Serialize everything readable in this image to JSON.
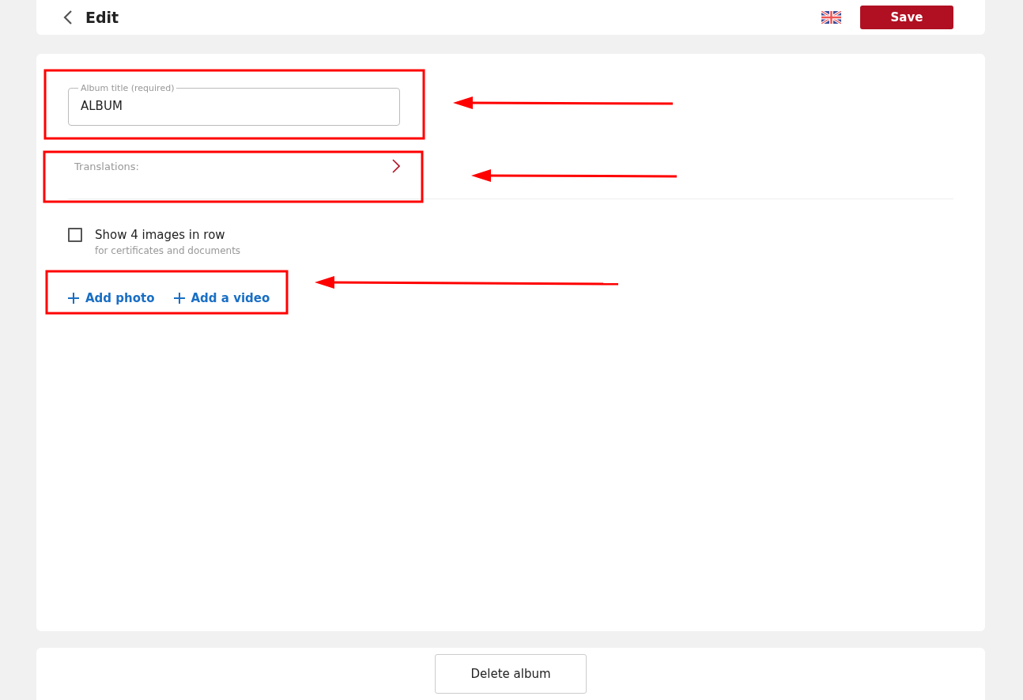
{
  "header": {
    "title": "Edit",
    "save_button": "Save"
  },
  "album_title": {
    "label": "Album title (required)",
    "value": "ALBUM"
  },
  "translations": {
    "label": "Translations:"
  },
  "show_four": {
    "label": "Show 4 images in row",
    "hint": "for certificates and documents",
    "checked": false
  },
  "actions": [
    {
      "label": "Add photo"
    },
    {
      "label": "Add a video"
    }
  ],
  "delete_button": "Delete album"
}
